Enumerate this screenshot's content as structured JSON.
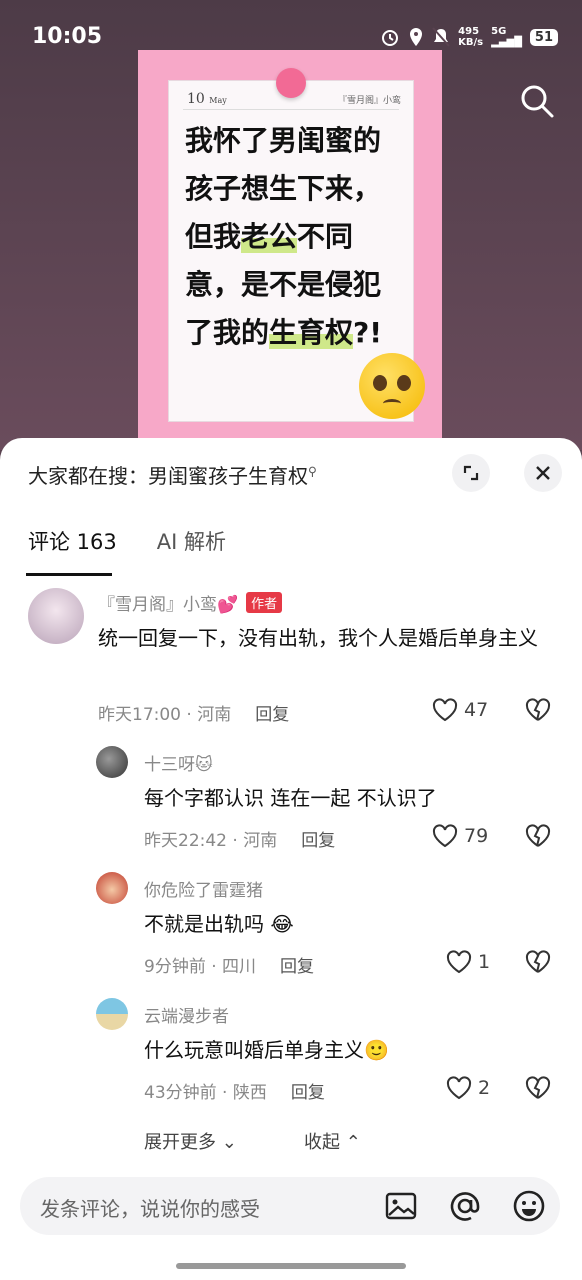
{
  "status_bar": {
    "time": "10:05",
    "speed_top": "495",
    "speed_bottom": "KB/s",
    "network": "5G",
    "battery": "51"
  },
  "poster": {
    "date": "10",
    "date_sub": "May",
    "brand": "『雪月阁』小鸾",
    "title_parts": [
      "我怀了男闺蜜的孩子想生下来，但我",
      "老公",
      "不同意，是不是侵犯了我的",
      "生育权",
      "?!"
    ]
  },
  "hot_search": {
    "label": "大家都在搜：",
    "term": "男闺蜜孩子生育权"
  },
  "tabs": {
    "comments": "评论 163",
    "ai": "AI 解析"
  },
  "comments": [
    {
      "user": "『雪月阁』小鸾💕",
      "badge": "作者",
      "text": "统一回复一下，没有出轨，我个人是婚后单身主义",
      "time": "昨天17:00 · 河南",
      "reply": "回复",
      "likes": "47"
    },
    {
      "user": "十三呀🐱",
      "text": "每个字都认识 连在一起 不认识了",
      "time": "昨天22:42 · 河南",
      "reply": "回复",
      "likes": "79"
    },
    {
      "user": "你危险了雷霆猪",
      "text": "不就是出轨吗",
      "time": "9分钟前 · 四川",
      "reply": "回复",
      "likes": "1"
    },
    {
      "user": "云端漫步者",
      "text": "什么玩意叫婚后单身主义",
      "time": "43分钟前 · 陕西",
      "reply": "回复",
      "likes": "2"
    }
  ],
  "expand": {
    "more": "展开更多",
    "collapse": "收起"
  },
  "input": {
    "placeholder": "发条评论，说说你的感受"
  }
}
